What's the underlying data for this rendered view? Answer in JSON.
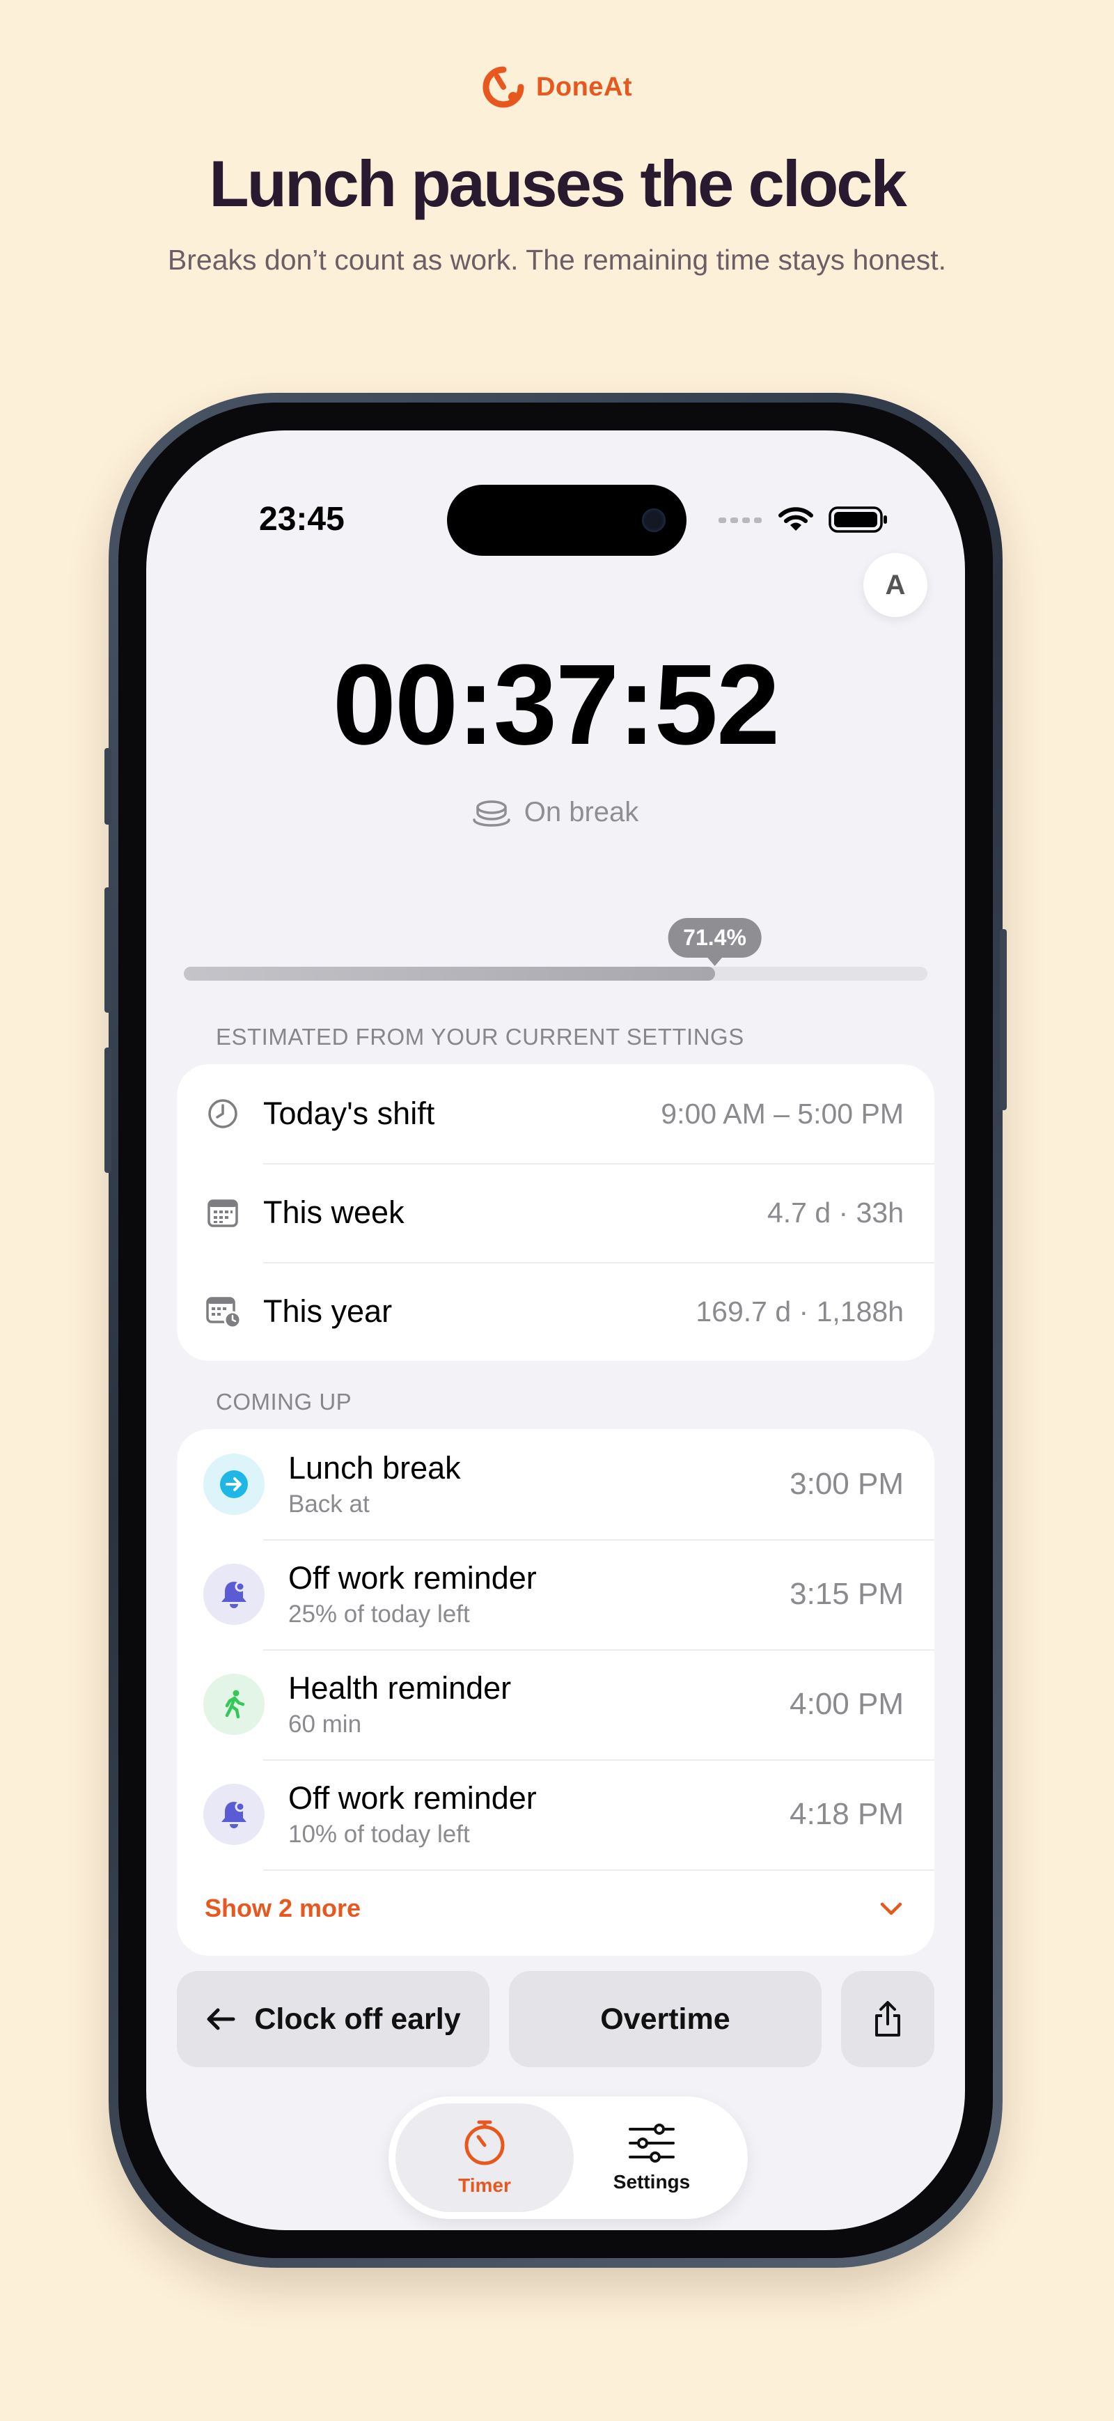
{
  "brand": {
    "name": "DoneAt",
    "logo_icon": "doneat-logo-icon",
    "color": "#e8571e"
  },
  "hero": {
    "headline": "Lunch pauses the clock",
    "subline": "Breaks don’t count as work. The remaining time stays honest."
  },
  "status_bar": {
    "time": "23:45"
  },
  "profile": {
    "avatar_initial": "A"
  },
  "timer": {
    "value": "00:37:52",
    "status": "On break",
    "status_icon": "coffee-cup-icon",
    "progress_label": "71.4%",
    "progress_fraction": 0.714
  },
  "estimates": {
    "section_label": "ESTIMATED FROM YOUR CURRENT SETTINGS",
    "rows": [
      {
        "icon": "clock-icon",
        "title": "Today's shift",
        "value": "9:00 AM – 5:00 PM"
      },
      {
        "icon": "calendar-icon",
        "title": "This week",
        "value": "4.7 d · 33h"
      },
      {
        "icon": "calendar-clock-icon",
        "title": "This year",
        "value": "169.7 d · 1,188h"
      }
    ]
  },
  "coming_up": {
    "section_label": "COMING UP",
    "items": [
      {
        "icon": "arrow-right-circle-icon",
        "icon_color": "#1fb8e6",
        "icon_bg": "#ddf4fb",
        "title": "Lunch break",
        "subtitle": "Back at",
        "time": "3:00 PM"
      },
      {
        "icon": "bell-icon",
        "icon_color": "#5b5bd6",
        "icon_bg": "#e8e8f7",
        "title": "Off work reminder",
        "subtitle": "25% of today left",
        "time": "3:15 PM"
      },
      {
        "icon": "walking-person-icon",
        "icon_color": "#34c759",
        "icon_bg": "#e2f5e6",
        "title": "Health reminder",
        "subtitle": "60 min",
        "time": "4:00 PM"
      },
      {
        "icon": "bell-icon",
        "icon_color": "#5b5bd6",
        "icon_bg": "#e8e8f7",
        "title": "Off work reminder",
        "subtitle": "10% of today left",
        "time": "4:18 PM"
      }
    ],
    "show_more_label": "Show 2 more"
  },
  "actions": {
    "clock_off_label": "Clock off early",
    "overtime_label": "Overtime",
    "share_icon": "share-icon"
  },
  "tabs": [
    {
      "label": "Timer",
      "icon": "timer-icon",
      "active": true,
      "color": "#e8571e"
    },
    {
      "label": "Settings",
      "icon": "sliders-icon",
      "active": false,
      "color": "#111111"
    }
  ]
}
